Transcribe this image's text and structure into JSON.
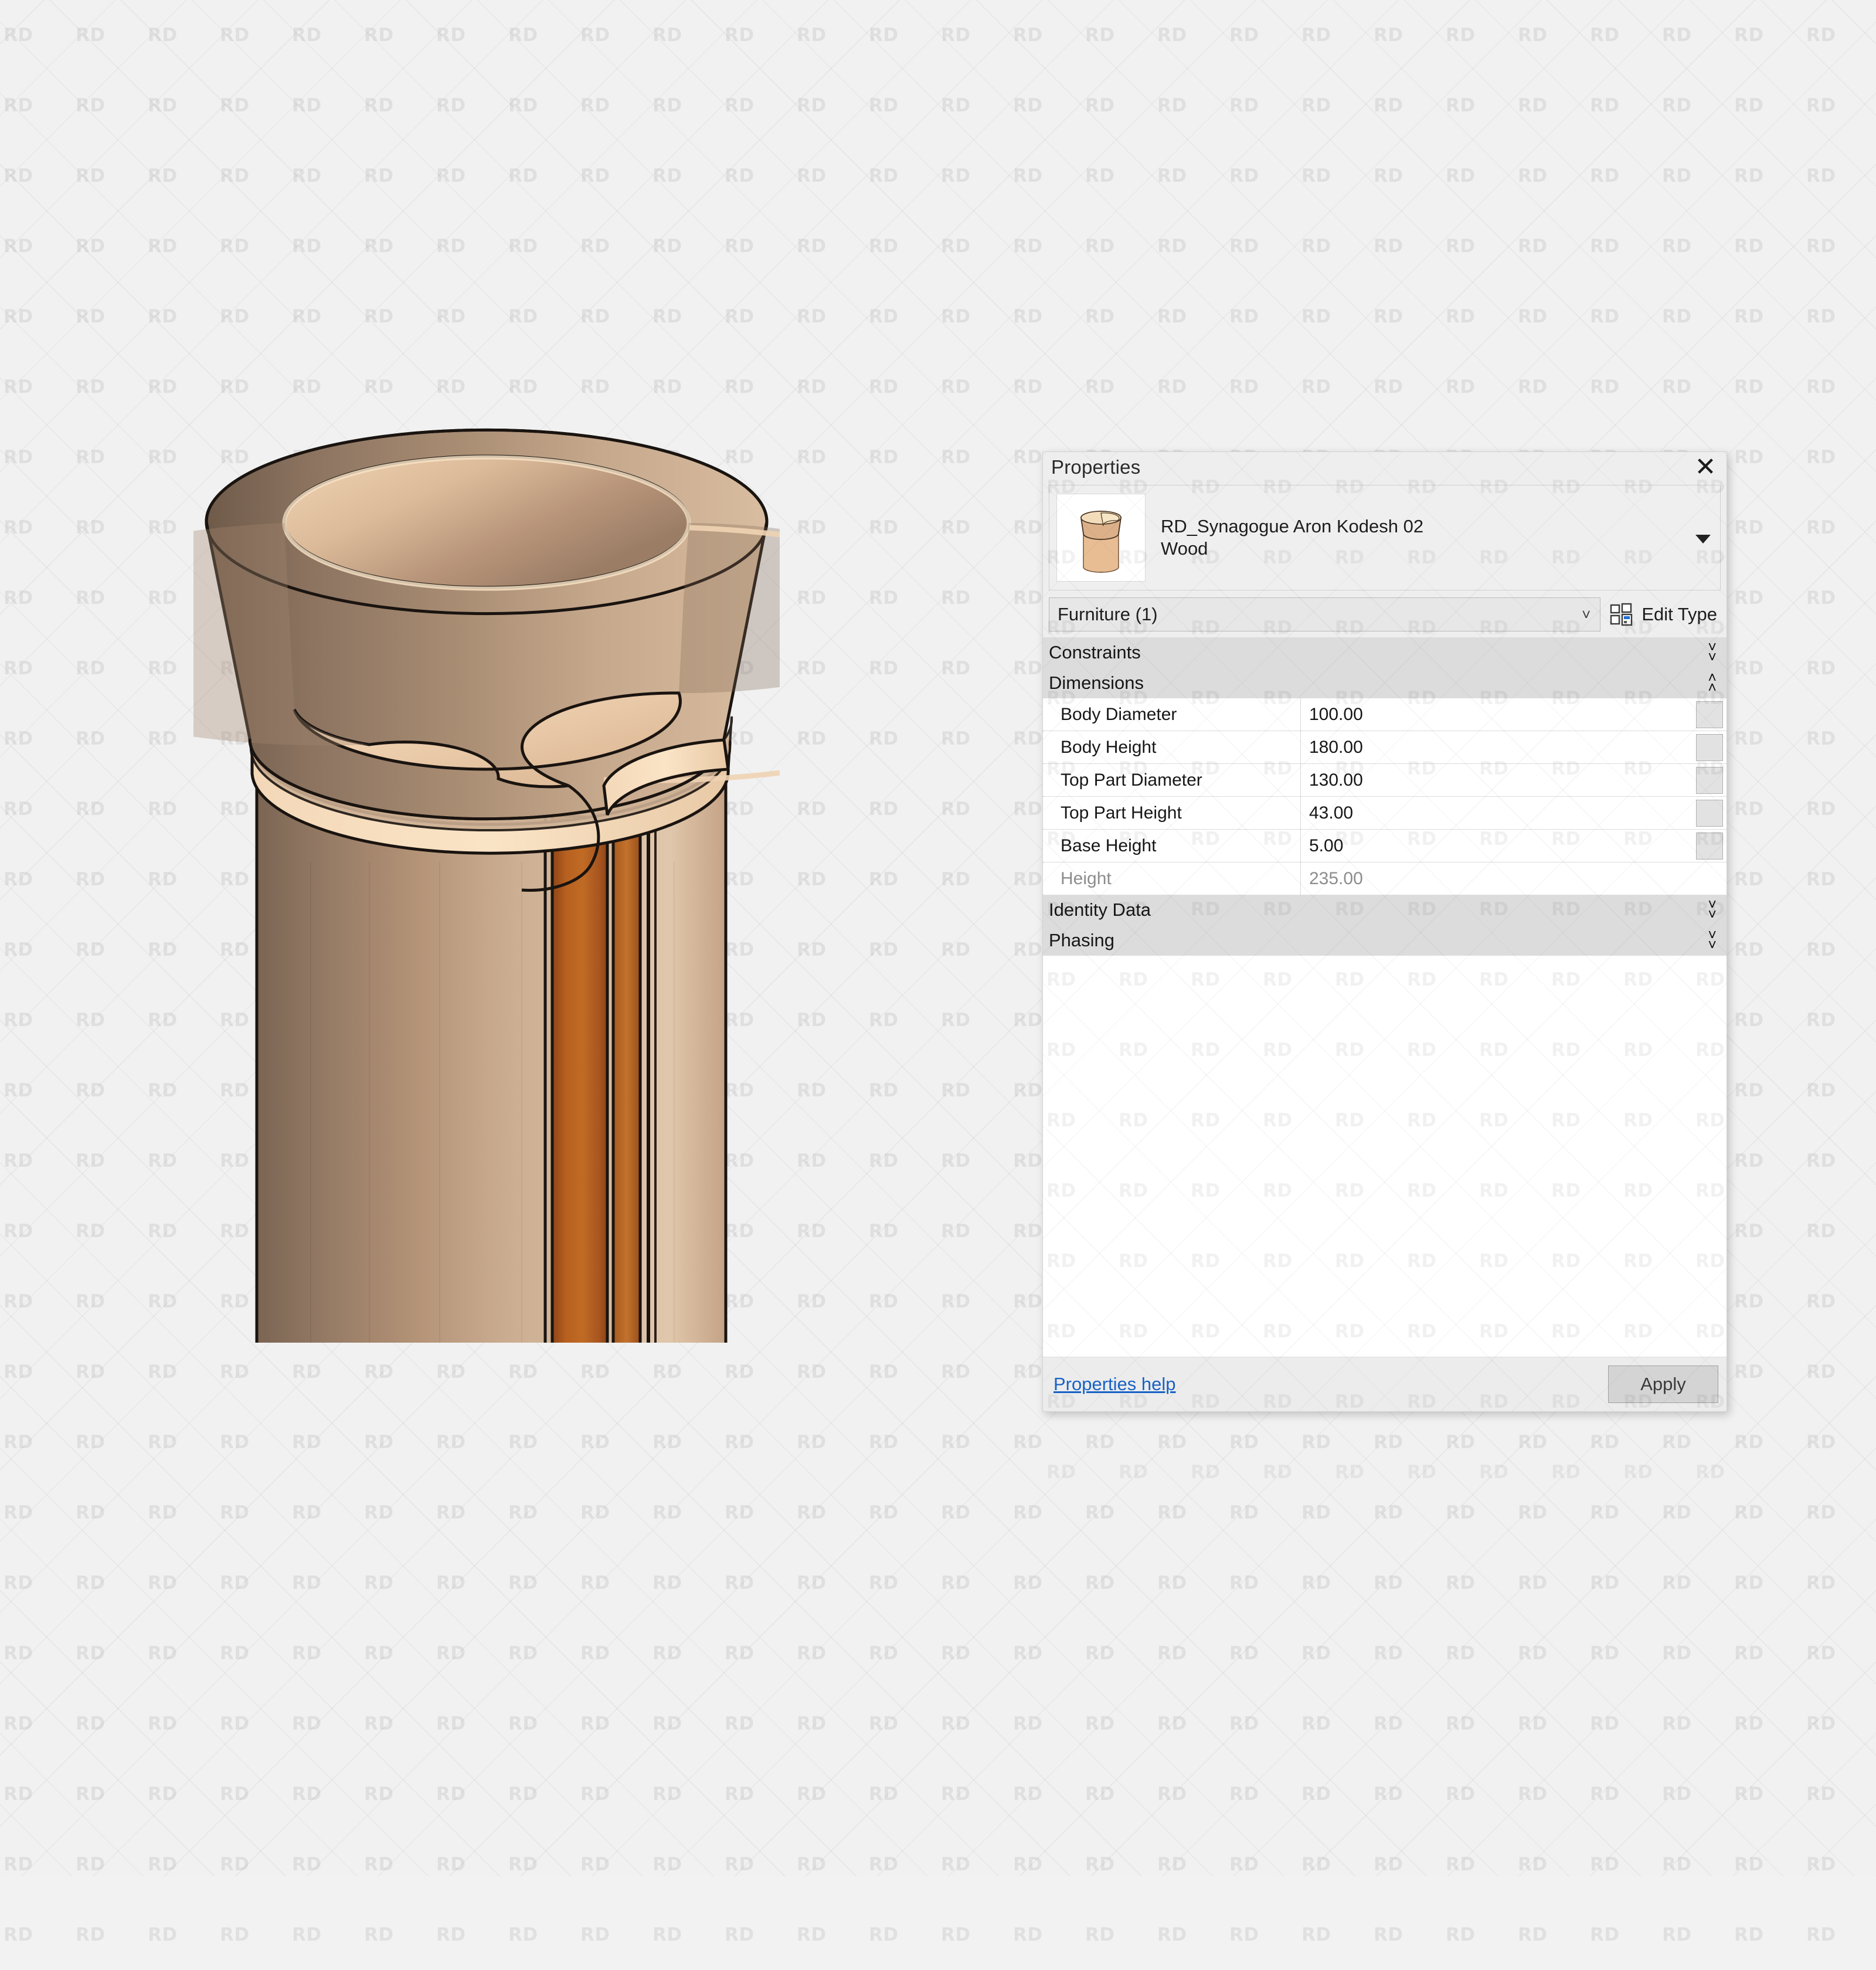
{
  "watermark": {
    "text": "RD"
  },
  "viewport": {
    "background_color": "#f1f1f1",
    "model": {
      "name": "RD_Synagogue Aron Kodesh 02 Wood",
      "description": "Cylindrical wooden Aron Kodesh with flared open top part and curved door panel",
      "colors": {
        "body_light": "#d9b391",
        "body_shadow": "#6e5a48",
        "body_mid": "#9a7e66",
        "interior_light": "#f0cfae",
        "rim_edge": "#f4d9bb",
        "door_panel": "#b4561f",
        "outline": "#1a1410"
      }
    }
  },
  "properties_palette": {
    "title": "Properties",
    "close_icon": "close-icon",
    "type_selector": {
      "thumbnail_icon": "family-thumbnail-icon",
      "family_name": "RD_Synagogue Aron Kodesh 02",
      "type_name": "Wood",
      "dropdown_caret_icon": "caret-down-icon"
    },
    "instance_selector": {
      "value": "Furniture (1)",
      "chevron_icon": "chevron-down-icon"
    },
    "edit_type": {
      "label": "Edit Type",
      "icon": "edit-type-icon"
    },
    "groups": [
      {
        "label": "Constraints",
        "expanded": false,
        "toggle_icon": "chevron-double-down-icon",
        "parameters": []
      },
      {
        "label": "Dimensions",
        "expanded": true,
        "toggle_icon": "chevron-double-up-icon",
        "parameters": [
          {
            "name": "Body Diameter",
            "value": "100.00",
            "readonly": false
          },
          {
            "name": "Body Height",
            "value": "180.00",
            "readonly": false
          },
          {
            "name": "Top Part Diameter",
            "value": "130.00",
            "readonly": false
          },
          {
            "name": "Top Part Height",
            "value": "43.00",
            "readonly": false
          },
          {
            "name": "Base Height",
            "value": "5.00",
            "readonly": false
          },
          {
            "name": "Height",
            "value": "235.00",
            "readonly": true
          }
        ]
      },
      {
        "label": "Identity Data",
        "expanded": false,
        "toggle_icon": "chevron-double-down-icon",
        "parameters": []
      },
      {
        "label": "Phasing",
        "expanded": false,
        "toggle_icon": "chevron-double-down-icon",
        "parameters": []
      }
    ],
    "footer": {
      "help_link": "Properties help",
      "apply_label": "Apply"
    },
    "accent_link_color": "#1862c6"
  }
}
